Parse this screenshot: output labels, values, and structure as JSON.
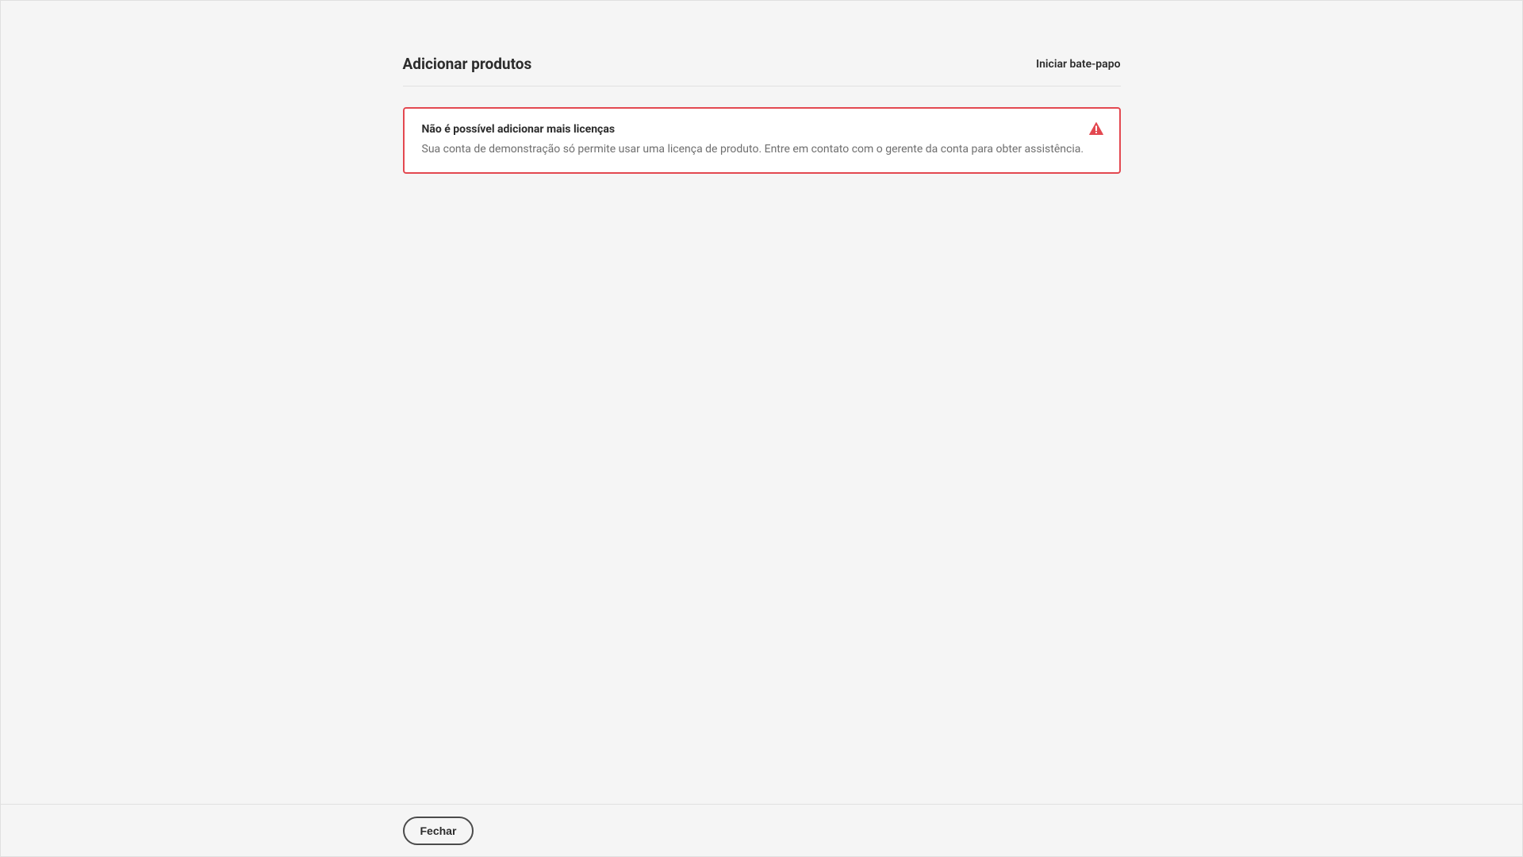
{
  "header": {
    "title": "Adicionar produtos",
    "chat_link": "Iniciar bate-papo"
  },
  "alert": {
    "title": "Não é possível adicionar mais licenças",
    "message": "Sua conta de demonstração só permite usar uma licença de produto. Entre em contato com o gerente da conta para obter assistência."
  },
  "footer": {
    "close_label": "Fechar"
  }
}
